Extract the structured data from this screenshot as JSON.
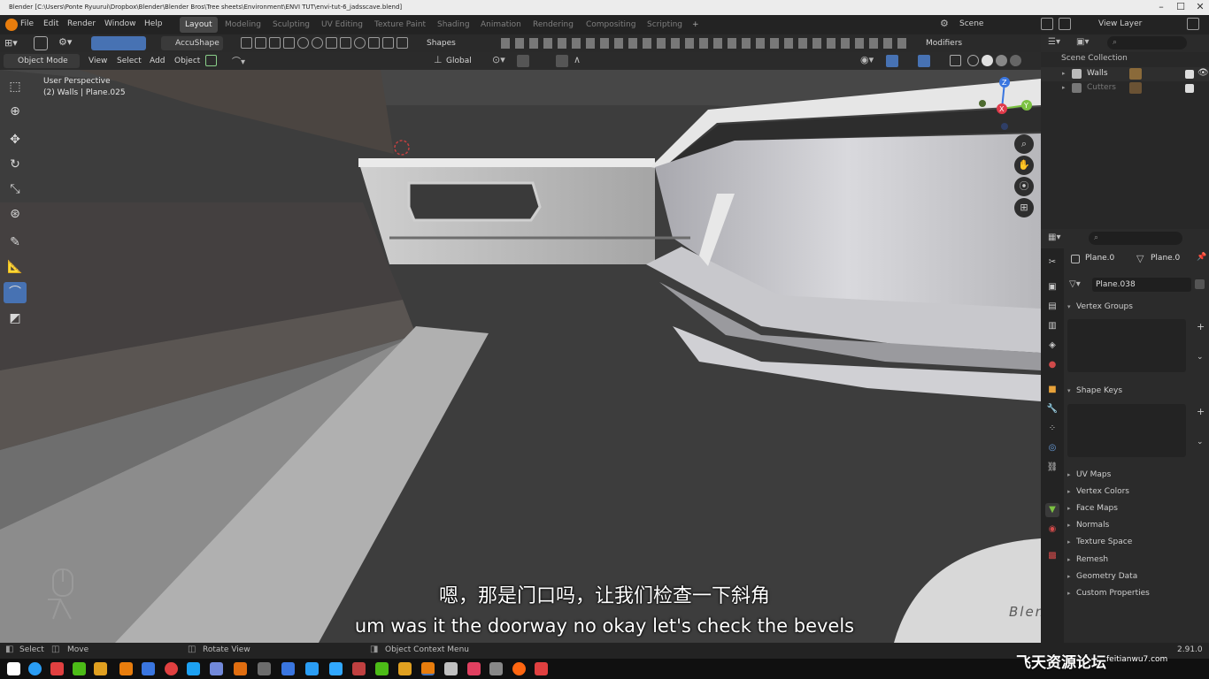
{
  "window": {
    "title": "Blender [C:\\Users\\Ponte Ryuurui\\Dropbox\\Blender\\Blender Bros\\Tree sheets\\Environment\\ENVI TUT\\envi-tut-6_jadsscave.blend]",
    "controls": [
      "–",
      "☐",
      "✕"
    ]
  },
  "menu": [
    "File",
    "Edit",
    "Render",
    "Window",
    "Help"
  ],
  "workspaces": [
    {
      "label": "Layout",
      "active": true
    },
    {
      "label": "Modeling",
      "active": false
    },
    {
      "label": "Sculpting",
      "active": false
    },
    {
      "label": "UV Editing",
      "active": false
    },
    {
      "label": "Texture Paint",
      "active": false
    },
    {
      "label": "Shading",
      "active": false
    },
    {
      "label": "Animation",
      "active": false
    },
    {
      "label": "Rendering",
      "active": false
    },
    {
      "label": "Compositing",
      "active": false
    },
    {
      "label": "Scripting",
      "active": false
    }
  ],
  "add_workspace": "+",
  "scene": {
    "label": "Scene",
    "view_layer": "View Layer"
  },
  "tool_header": {
    "accushape": "AccuShape",
    "shapes": "Shapes",
    "modifiers": "Modifiers"
  },
  "viewport_header": {
    "mode": "Object Mode",
    "view": "View",
    "select": "Select",
    "add": "Add",
    "object": "Object",
    "orientation": "Global"
  },
  "viewport": {
    "perspective": "User Perspective",
    "object_info": "(2) Walls | Plane.025",
    "gizmo": {
      "z": "Z",
      "y": "Y",
      "x": "X"
    },
    "watermark": "Blender Bros"
  },
  "subtitles": {
    "zh": "嗯，那是门口吗，让我们检查一下斜角",
    "en": "um was it the doorway no okay let's check the bevels"
  },
  "outliner": {
    "header": "Scene Collection",
    "items": [
      {
        "label": "Walls",
        "checked": true
      },
      {
        "label": "Cutters",
        "checked": true
      }
    ]
  },
  "properties": {
    "object_name": "Plane.0",
    "data_name": "Plane.0",
    "mesh_name": "Plane.038",
    "panels_open": [
      "Vertex Groups",
      "Shape Keys"
    ],
    "panels_closed": [
      "UV Maps",
      "Vertex Colors",
      "Face Maps",
      "Normals",
      "Texture Space",
      "Remesh",
      "Geometry Data",
      "Custom Properties"
    ]
  },
  "statusbar": {
    "select": "Select",
    "move": "Move",
    "rotate_view": "Rotate View",
    "context_menu": "Object Context Menu",
    "version": "2.91.0"
  },
  "branding": {
    "site_name": "飞天资源论坛",
    "site_url": "feitianwu7.com"
  },
  "colors": {
    "accent": "#4772b3",
    "axis_x": "#e03a4a",
    "axis_y": "#7cc242",
    "axis_z": "#3a76e0"
  }
}
